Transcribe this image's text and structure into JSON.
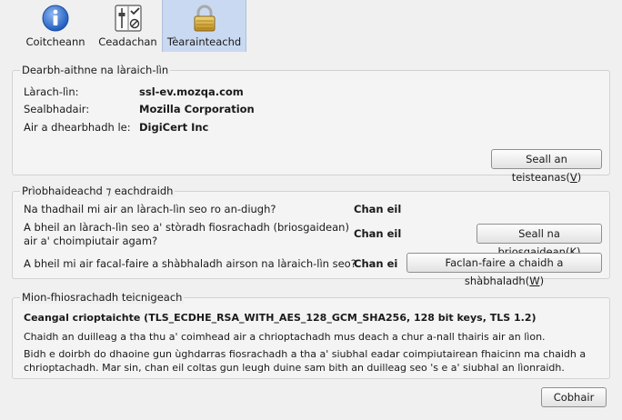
{
  "tabs": [
    {
      "label": "Coitcheann",
      "icon": "info-icon",
      "selected": false
    },
    {
      "label": "Ceadachan",
      "icon": "permissions-icon",
      "selected": false
    },
    {
      "label": "Tèarainteachd",
      "icon": "padlock-icon",
      "selected": true
    }
  ],
  "identity": {
    "legend": "Dearbh-aithne na làraich-lìn",
    "website_label": "Làrach-lìn:",
    "website_value": "ssl-ev.mozqa.com",
    "owner_label": "Sealbhadair:",
    "owner_value": "Mozilla Corporation",
    "verifier_label": "Air a dhearbhadh le:",
    "verifier_value": "DigiCert Inc",
    "view_cert_button": "Seall an teisteanas",
    "view_cert_key": "V"
  },
  "privacy": {
    "legend": "Prìobhaideachd ⁊ eachdraidh",
    "q1": "Na thadhail mi air an làrach-lìn seo ro an-diugh?",
    "a1": "Chan eil",
    "q2_line1": "A bheil an làrach-lìn seo a' stòradh fiosrachadh (briosgaidean)",
    "q2_line2": "air a' choimpiutair agam?",
    "a2": "Chan eil",
    "cookies_button": "Seall na briosgaidean",
    "cookies_key": "K",
    "q3": "A bheil mi air facal-faire a shàbhaladh airson na làraich-lìn seo?",
    "a3": "Chan ei",
    "passwords_button": "Faclan-faire a chaidh a shàbhaladh",
    "passwords_key": "W"
  },
  "technical": {
    "legend": "Mion-fhiosrachadh teicnigeach",
    "cipher": "Ceangal crioptaichte (TLS_ECDHE_RSA_WITH_AES_128_GCM_SHA256, 128 bit keys, TLS 1.2)",
    "line1": "Chaidh an duilleag a tha thu a' coimhead air a chrioptachadh mus deach a chur a-nall thairis air an lìon.",
    "line2": "Bidh e doirbh do dhaoine gun ùghdarras fiosrachadh a tha a' siubhal eadar coimpiutairean fhaicinn ma chaidh a",
    "line3": "chrioptachadh. Mar sin, chan eil coltas gun leugh duine sam bith an duilleag seo 's e a' siubhal an lìonraidh."
  },
  "close_button": "Cobhair"
}
